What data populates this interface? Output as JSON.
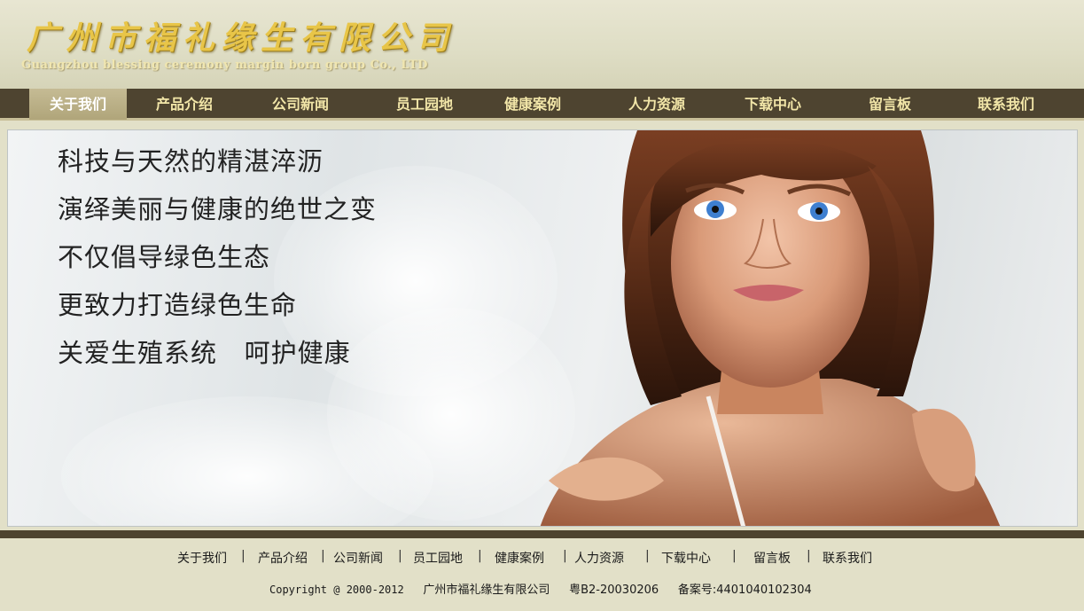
{
  "header": {
    "company_name_cn": "广州市福礼缘生有限公司",
    "company_name_en": "Guangzhou blessing ceremony margin born group Co., LTD"
  },
  "nav": {
    "items": [
      {
        "label": "关于我们",
        "active": true
      },
      {
        "label": "产品介绍",
        "active": false
      },
      {
        "label": "公司新闻",
        "active": false
      },
      {
        "label": "员工园地",
        "active": false
      },
      {
        "label": "健康案例",
        "active": false
      },
      {
        "label": "人力资源",
        "active": false
      },
      {
        "label": "下载中心",
        "active": false
      },
      {
        "label": "留言板",
        "active": false
      },
      {
        "label": "联系我们",
        "active": false
      }
    ]
  },
  "banner": {
    "lines": [
      "科技与天然的精湛淬沥",
      "演绎美丽与健康的绝世之变",
      "不仅倡导绿色生态",
      "更致力打造绿色生命",
      "关爱生殖系统   呵护健康"
    ]
  },
  "footer": {
    "links": [
      "关于我们",
      "产品介绍",
      "公司新闻",
      "员工园地",
      "健康案例",
      "人力资源",
      "下载中心",
      "留言板",
      "联系我们"
    ],
    "separator": "|",
    "copyright": "Copyright @ 2000-2012",
    "company": "广州市福礼缘生有限公司",
    "icp": "粤B2-20030206",
    "record": "备案号:4401040102304"
  },
  "colors": {
    "nav_background": "#4e4430",
    "nav_text": "#f2e6a8",
    "nav_active_background": "#b0a57a",
    "page_background": "#e2e0c8",
    "brand_gold": "#e8c548"
  }
}
